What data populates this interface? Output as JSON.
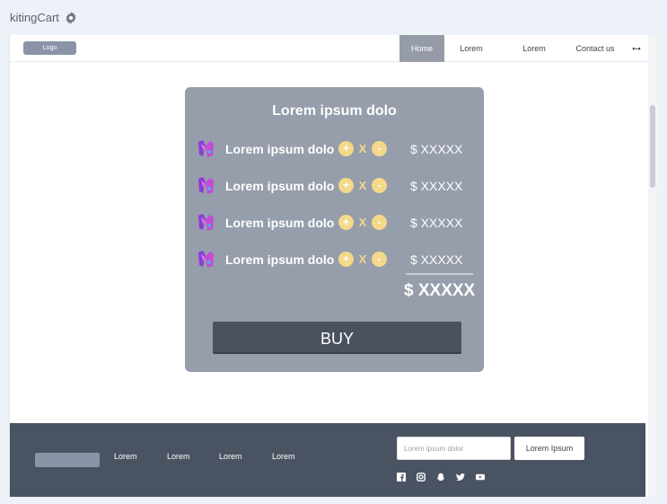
{
  "app": {
    "title": "kitingCart"
  },
  "nav": {
    "logo": "Logo",
    "items": [
      "Home",
      "Lorem",
      "Lorem",
      "Contact us"
    ],
    "more": "•-•"
  },
  "cart": {
    "title": "Lorem ipsum dolo",
    "rows": [
      {
        "label": "Lorem ipsum dolo",
        "plus": "+",
        "times": "X",
        "minus": "-",
        "price": "$ XXXXX"
      },
      {
        "label": "Lorem ipsum dolo",
        "plus": "+",
        "times": "X",
        "minus": "-",
        "price": "$ XXXXX"
      },
      {
        "label": "Lorem ipsum dolo",
        "plus": "+",
        "times": "X",
        "minus": "-",
        "price": "$ XXXXX"
      },
      {
        "label": "Lorem ipsum dolo",
        "plus": "+",
        "times": "X",
        "minus": "-",
        "price": "$ XXXXX"
      }
    ],
    "total": "$ XXXXX",
    "buy_label": "BUY"
  },
  "footer": {
    "links": [
      "Lorem",
      "Lorem",
      "Lorem",
      "Lorem"
    ],
    "input_placeholder": "Lorem ipsum dolor",
    "button_label": "Lorem Ipsum",
    "social_icons": [
      "facebook-icon",
      "instagram-icon",
      "snapchat-icon",
      "twitter-icon",
      "youtube-icon"
    ]
  },
  "colors": {
    "card": "#969dab",
    "footer": "#4a5361",
    "qty_button": "#f4d98a",
    "buy_button": "#4a5260"
  }
}
